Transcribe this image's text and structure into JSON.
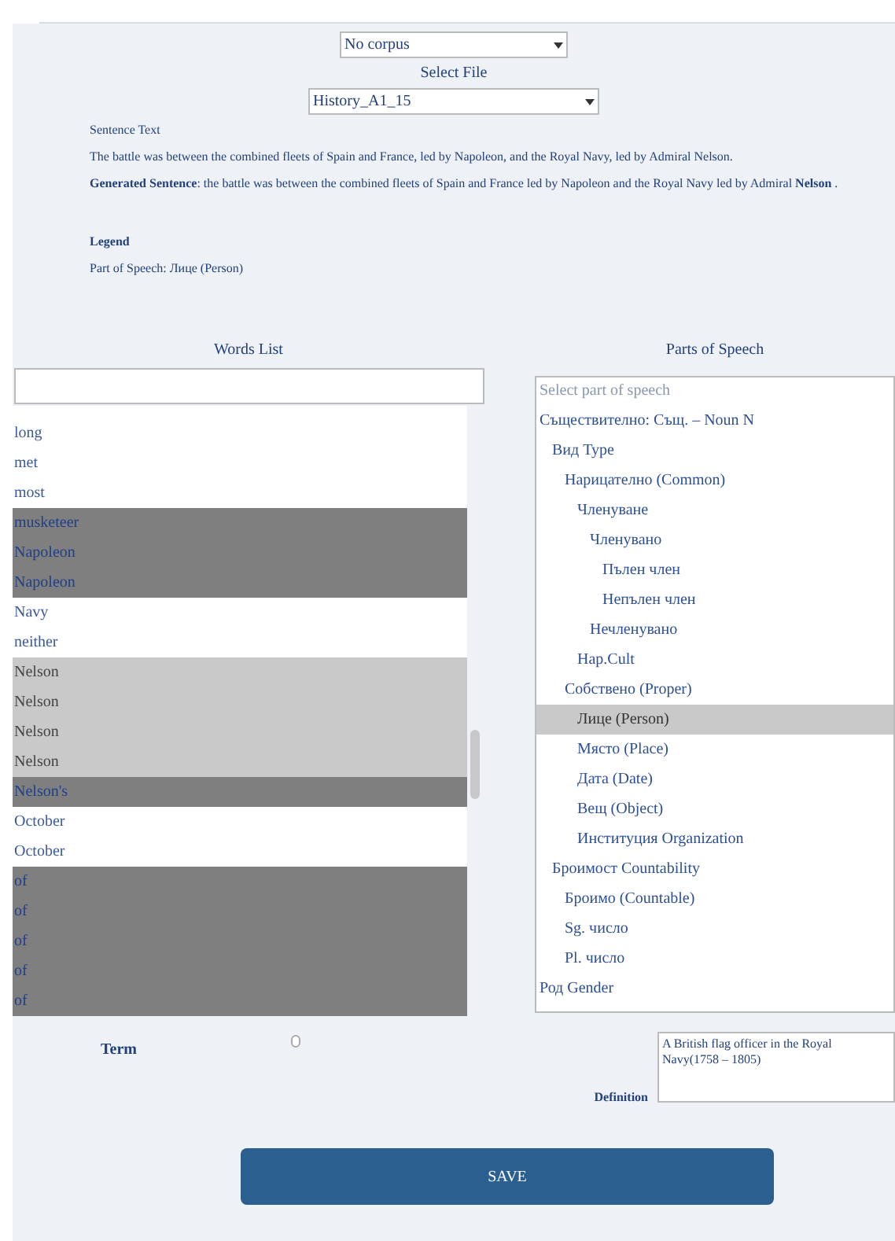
{
  "corpus_select": {
    "value": "No corpus"
  },
  "file_label": "Select File",
  "file_select": {
    "value": "History_A1_15"
  },
  "sentence_label": "Sentence Text",
  "sentence": "The battle was between the combined fleets of Spain and France, led by Napoleon, and the Royal Navy, led by Admiral Nelson.",
  "generated": "**Generated Sentence**: the battle was between the combined fleets of Spain and France led by Napoleon and the Royal Navy led by Admiral **Nelson** .",
  "legend_label": "Legend",
  "legend_text": "Part of Speech: Лице (Person)",
  "words_heading": "Words List",
  "words": [
    {
      "text": "long",
      "selected": false,
      "matched": false
    },
    {
      "text": "met",
      "selected": false,
      "matched": false
    },
    {
      "text": "most",
      "selected": false,
      "matched": false
    },
    {
      "text": "musketeer",
      "selected": true,
      "matched": false
    },
    {
      "text": "Napoleon",
      "selected": true,
      "matched": false
    },
    {
      "text": "Napoleon",
      "selected": true,
      "matched": false
    },
    {
      "text": "Navy",
      "selected": false,
      "matched": false
    },
    {
      "text": "neither",
      "selected": false,
      "matched": false
    },
    {
      "text": "Nelson",
      "selected": false,
      "matched": true
    },
    {
      "text": "Nelson",
      "selected": false,
      "matched": true
    },
    {
      "text": "Nelson",
      "selected": false,
      "matched": true
    },
    {
      "text": "Nelson",
      "selected": false,
      "matched": true
    },
    {
      "text": "Nelson's",
      "selected": true,
      "matched": false
    },
    {
      "text": "October",
      "selected": false,
      "matched": false
    },
    {
      "text": "October",
      "selected": false,
      "matched": false
    },
    {
      "text": "of",
      "selected": true,
      "matched": false
    },
    {
      "text": "of",
      "selected": true,
      "matched": false
    },
    {
      "text": "of",
      "selected": true,
      "matched": false
    },
    {
      "text": "of",
      "selected": true,
      "matched": false
    },
    {
      "text": "of",
      "selected": true,
      "matched": false
    }
  ],
  "pos_heading": "Parts of Speech",
  "pos_placeholder": "Select part of speech",
  "pos_tree": [
    {
      "label": "Съществително: Същ. – Noun N",
      "selected": false,
      "children": [
        {
          "label": "Вид Type",
          "selected": false,
          "children": [
            {
              "label": "Нарицателно (Common)",
              "selected": false,
              "children": [
                {
                  "label": "Членуване",
                  "selected": false,
                  "children": [
                    {
                      "label": "Членувано",
                      "selected": false,
                      "children": [
                        {
                          "label": "Пълен член",
                          "selected": false
                        },
                        {
                          "label": "Непълен член",
                          "selected": false
                        }
                      ]
                    },
                    {
                      "label": "Нечленувано",
                      "selected": false
                    }
                  ]
                },
                {
                  "label": "Нар.Cult",
                  "selected": false
                }
              ]
            },
            {
              "label": "Собствено (Proper)",
              "selected": false,
              "children": [
                {
                  "label": "Лице (Person)",
                  "selected": true
                },
                {
                  "label": "Място (Place)",
                  "selected": false
                },
                {
                  "label": "Дата (Date)",
                  "selected": false
                },
                {
                  "label": "Вещ (Object)",
                  "selected": false
                },
                {
                  "label": "Институция Organization",
                  "selected": false
                }
              ]
            }
          ]
        },
        {
          "label": "Броимост Countability",
          "selected": false,
          "children": [
            {
              "label": "Броимо (Countable)",
              "selected": false
            },
            {
              "label": "Sg. число",
              "selected": false
            },
            {
              "label": "Pl. число",
              "selected": false
            }
          ]
        }
      ]
    },
    {
      "label": "Род Gender",
      "selected": false
    }
  ],
  "term_label": "Term",
  "term_checkbox": {
    "checked": false
  },
  "definition_label": "Definition",
  "definition": "A British flag officer in the Royal Navy(1758 – 1805)",
  "save_button": "SAVE"
}
